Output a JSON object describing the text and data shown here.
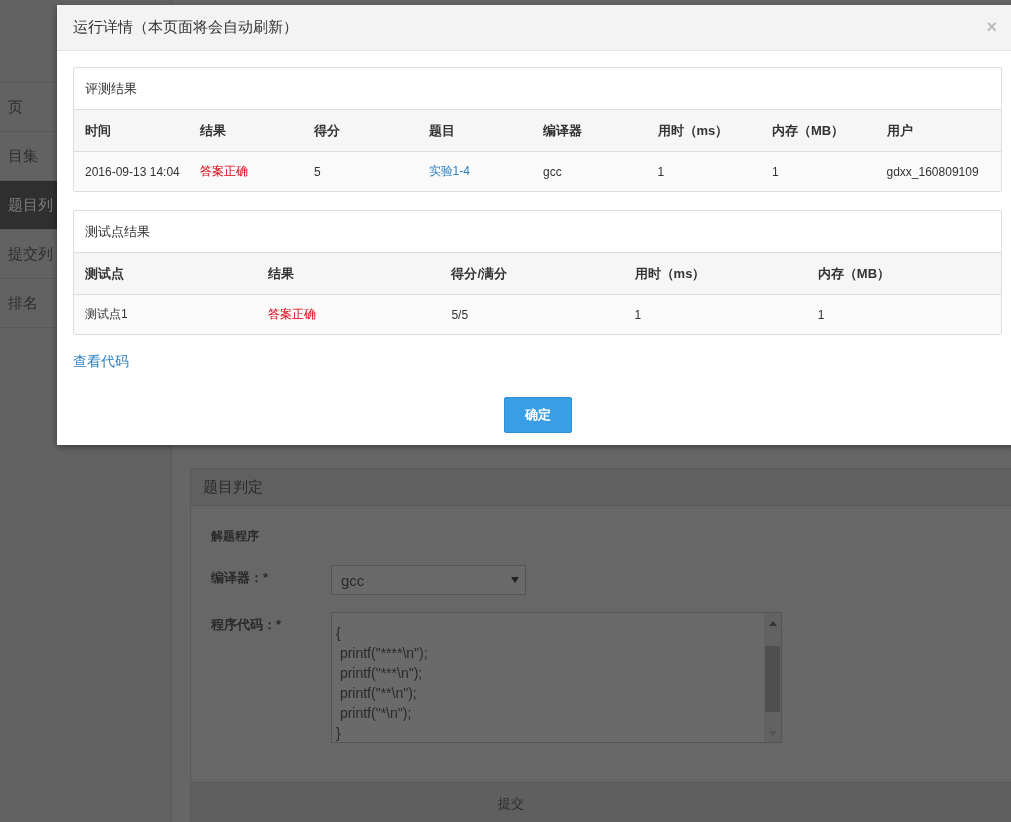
{
  "sidebar": {
    "items": [
      {
        "label": "页",
        "selected": false
      },
      {
        "label": "目集",
        "selected": false
      },
      {
        "label": "题目列",
        "selected": true
      },
      {
        "label": "提交列",
        "selected": false
      },
      {
        "label": "排名",
        "selected": false
      }
    ]
  },
  "main": {
    "panel_title": "题目判定",
    "section_title": "解题程序",
    "compiler_label": "编译器：*",
    "compiler_value": "gcc",
    "code_label": "程序代码：*",
    "code_lines": [
      "{",
      " printf(\"****\\n\");",
      " printf(\"***\\n\");",
      " printf(\"**\\n\");",
      " printf(\"*\\n\");",
      "}"
    ],
    "submit": "提交"
  },
  "dialog": {
    "title": "运行详情（本页面将会自动刷新）",
    "close": "×",
    "cards": [
      {
        "title": "评测结果",
        "columns": [
          "时间",
          "结果",
          "得分",
          "题目",
          "编译器",
          "用时（ms）",
          "内存（MB）",
          "用户"
        ],
        "rows": [
          [
            {
              "text": "2016-09-13 14:04",
              "kind": "text"
            },
            {
              "text": "答案正确",
              "kind": "status"
            },
            {
              "text": "5",
              "kind": "text"
            },
            {
              "text": "实验1-4",
              "kind": "link"
            },
            {
              "text": "gcc",
              "kind": "text"
            },
            {
              "text": "1",
              "kind": "text"
            },
            {
              "text": "1",
              "kind": "text"
            },
            {
              "text": "gdxx_160809109",
              "kind": "text"
            }
          ]
        ]
      },
      {
        "title": "测试点结果",
        "columns": [
          "测试点",
          "结果",
          "得分/满分",
          "用时（ms）",
          "内存（MB）"
        ],
        "rows": [
          [
            {
              "text": "测试点1",
              "kind": "text"
            },
            {
              "text": "答案正确",
              "kind": "status"
            },
            {
              "text": "5/5",
              "kind": "text"
            },
            {
              "text": "1",
              "kind": "text"
            },
            {
              "text": "1",
              "kind": "text"
            }
          ]
        ]
      }
    ],
    "view_code": "查看代码",
    "ok": "确定"
  }
}
